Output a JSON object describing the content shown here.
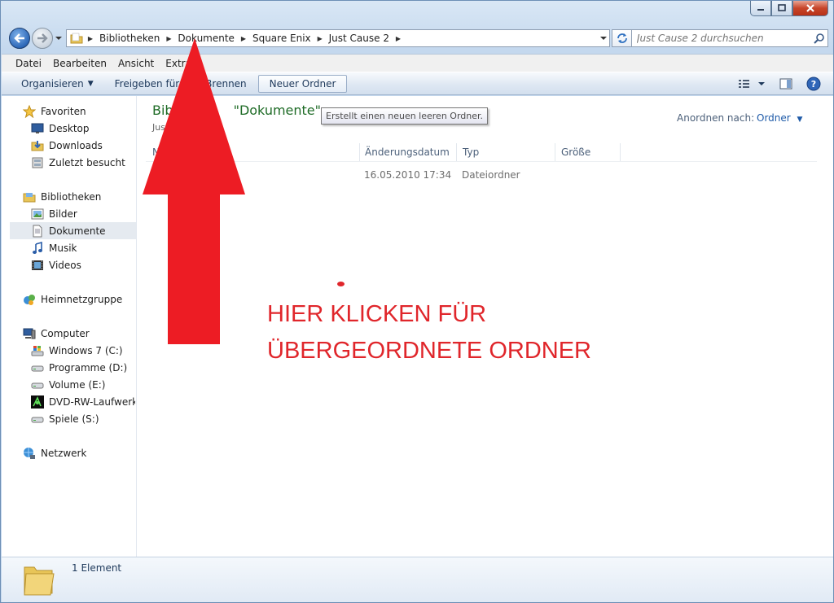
{
  "window": {
    "caption_buttons": [
      "minimize",
      "maximize",
      "close"
    ]
  },
  "navigation": {
    "back_icon": "back-arrow-icon",
    "forward_icon": "forward-arrow-icon"
  },
  "address_bar": {
    "breadcrumbs": [
      "Bibliotheken",
      "Dokumente",
      "Square Enix",
      "Just Cause 2"
    ]
  },
  "search": {
    "placeholder": "Just Cause 2 durchsuchen"
  },
  "menubar": {
    "items": [
      "Datei",
      "Bearbeiten",
      "Ansicht",
      "Extras"
    ]
  },
  "commandbar": {
    "organize": "Organisieren",
    "share": "Freigeben für",
    "burn": "Brennen",
    "new_folder": "Neuer Ordner"
  },
  "sidebar": {
    "favorites": {
      "label": "Favoriten",
      "items": [
        "Desktop",
        "Downloads",
        "Zuletzt besucht"
      ]
    },
    "libraries": {
      "label": "Bibliotheken",
      "items": [
        "Bilder",
        "Dokumente",
        "Musik",
        "Videos"
      ],
      "selected": "Dokumente"
    },
    "homegroup": {
      "label": "Heimnetzgruppe"
    },
    "computer": {
      "label": "Computer",
      "items": [
        "Windows 7 (C:)",
        "Programme (D:)",
        "Volume (E:)",
        "DVD-RW-Laufwerk (",
        "Spiele (S:)"
      ]
    },
    "network": {
      "label": "Netzwerk"
    }
  },
  "main": {
    "title_prefix": "Bib",
    "title_suffix": "\"Dokumente\"",
    "subtitle": "Jus",
    "tooltip": "Erstellt einen neuen leeren Ordner.",
    "arrange_label": "Anordnen nach:",
    "arrange_value": "Ordner",
    "columns": {
      "name": "N",
      "modified": "Änderungsdatum",
      "type": "Typ",
      "size": "Größe"
    },
    "rows": [
      {
        "modified": "16.05.2010 17:34",
        "type": "Dateiordner"
      }
    ]
  },
  "annotation": {
    "line1": "HIER KLICKEN FÜR",
    "line2": "ÜBERGEORDNETE ORDNER",
    "color": "#e0262b"
  },
  "details": {
    "count": "1 Element"
  }
}
